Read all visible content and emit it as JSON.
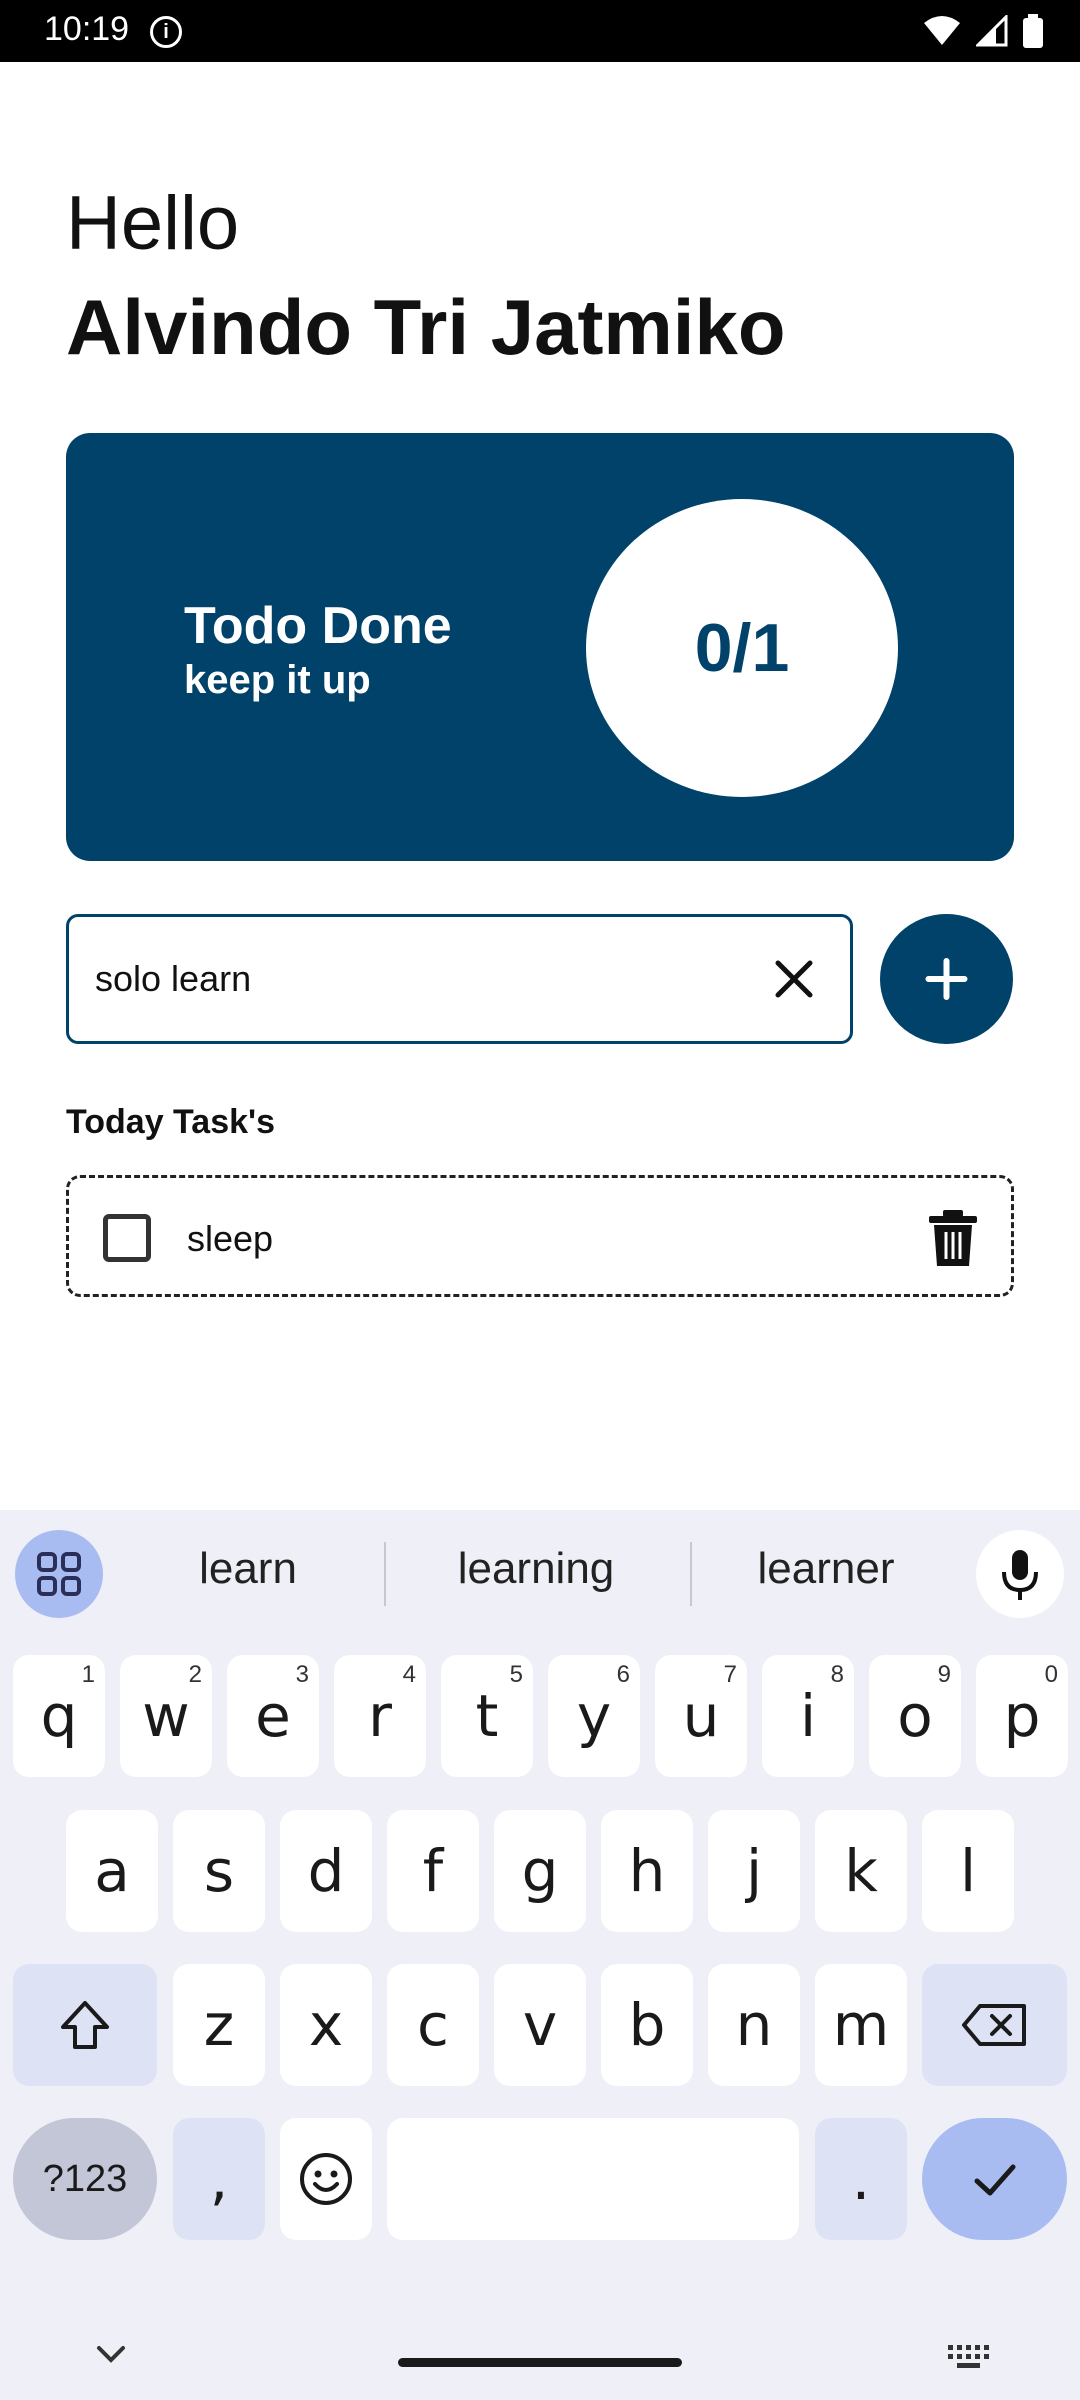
{
  "status_bar": {
    "time": "10:19",
    "info_icon": "i"
  },
  "greeting": {
    "hello": "Hello",
    "name": "Alvindo Tri Jatmiko"
  },
  "summary": {
    "title": "Todo Done",
    "subtitle": "keep it up",
    "progress_text": "0/1",
    "color": "#00426a"
  },
  "input": {
    "value": "solo learn"
  },
  "today": {
    "title": "Today Task's",
    "tasks": [
      {
        "label": "sleep",
        "checked": false
      }
    ]
  },
  "keyboard": {
    "suggestions": [
      "learn",
      "learning",
      "learner"
    ],
    "row1": [
      {
        "k": "q",
        "n": "1"
      },
      {
        "k": "w",
        "n": "2"
      },
      {
        "k": "e",
        "n": "3"
      },
      {
        "k": "r",
        "n": "4"
      },
      {
        "k": "t",
        "n": "5"
      },
      {
        "k": "y",
        "n": "6"
      },
      {
        "k": "u",
        "n": "7"
      },
      {
        "k": "i",
        "n": "8"
      },
      {
        "k": "o",
        "n": "9"
      },
      {
        "k": "p",
        "n": "0"
      }
    ],
    "row2": [
      "a",
      "s",
      "d",
      "f",
      "g",
      "h",
      "j",
      "k",
      "l"
    ],
    "row3": [
      "z",
      "x",
      "c",
      "v",
      "b",
      "n",
      "m"
    ],
    "symbols_label": "?123",
    "comma": ",",
    "period": ".",
    "accent_color": "#a8bcf2"
  }
}
